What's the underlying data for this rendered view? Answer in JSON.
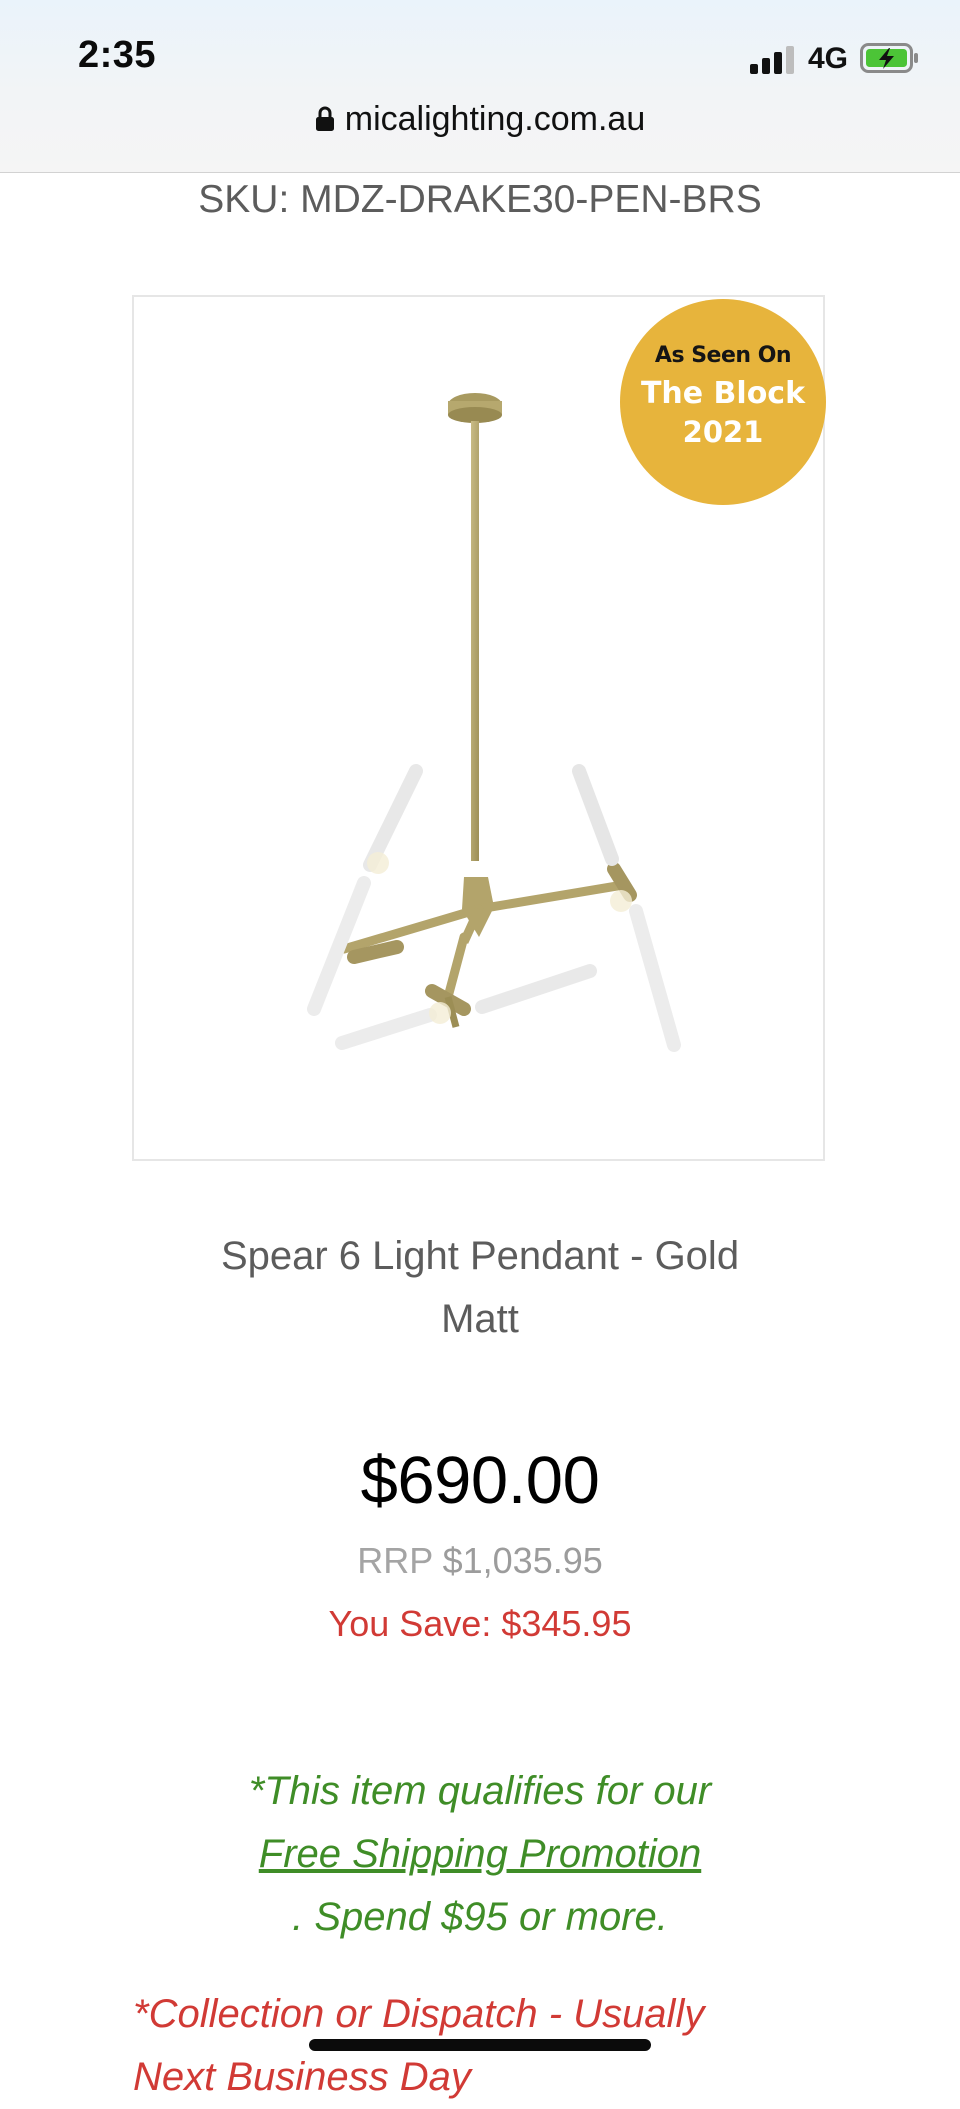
{
  "status_bar": {
    "time": "2:35",
    "network": "4G",
    "signal_bars": 3,
    "battery_state": "charging",
    "url": "micalighting.com.au"
  },
  "product": {
    "sku_label": "SKU:",
    "sku": "MDZ-DRAKE30-PEN-BRS",
    "badge": {
      "line1": "As Seen On",
      "line2": "The Block",
      "line3": "2021",
      "color": "#e7b43c"
    },
    "name_line1": "Spear 6 Light Pendant - Gold",
    "name_line2": "Matt",
    "price": "$690.00",
    "rrp_label": "RRP",
    "rrp_value": "$1,035.95",
    "save_label": "You Save:",
    "save_value": "$345.95"
  },
  "shipping": {
    "line1": "*This item qualifies for our",
    "link": "Free Shipping Promotion",
    "line3": ". Spend $95 or more."
  },
  "dispatch": {
    "line1": "*Collection or Dispatch - Usually",
    "line2": "Next Business Day"
  },
  "colors": {
    "accent_red": "#d13a35",
    "accent_green": "#3f8d27",
    "badge_gold": "#e7b43c",
    "lamp_brass": "#b3a46b"
  }
}
